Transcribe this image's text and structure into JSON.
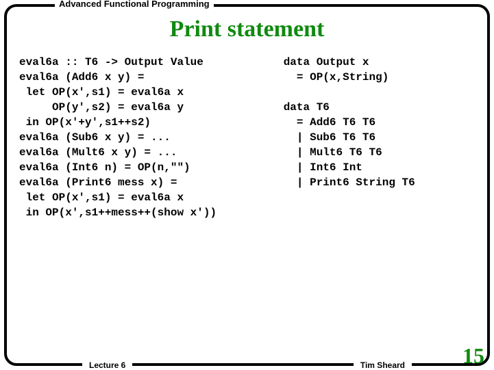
{
  "header": "Advanced Functional Programming",
  "title": "Print statement",
  "code_left": "eval6a :: T6 -> Output Value\neval6a (Add6 x y) =\n let OP(x',s1) = eval6a x\n     OP(y',s2) = eval6a y\n in OP(x'+y',s1++s2)\neval6a (Sub6 x y) = ...\neval6a (Mult6 x y) = ...\neval6a (Int6 n) = OP(n,\"\")\neval6a (Print6 mess x) =\n let OP(x',s1) = eval6a x\n in OP(x',s1++mess++(show x'))",
  "code_right": "data Output x\n  = OP(x,String)\n\ndata T6\n  = Add6 T6 T6\n  | Sub6 T6 T6\n  | Mult6 T6 T6\n  | Int6 Int\n  | Print6 String T6",
  "footer_left": "Lecture 6",
  "footer_right": "Tim Sheard",
  "page_number": "15"
}
